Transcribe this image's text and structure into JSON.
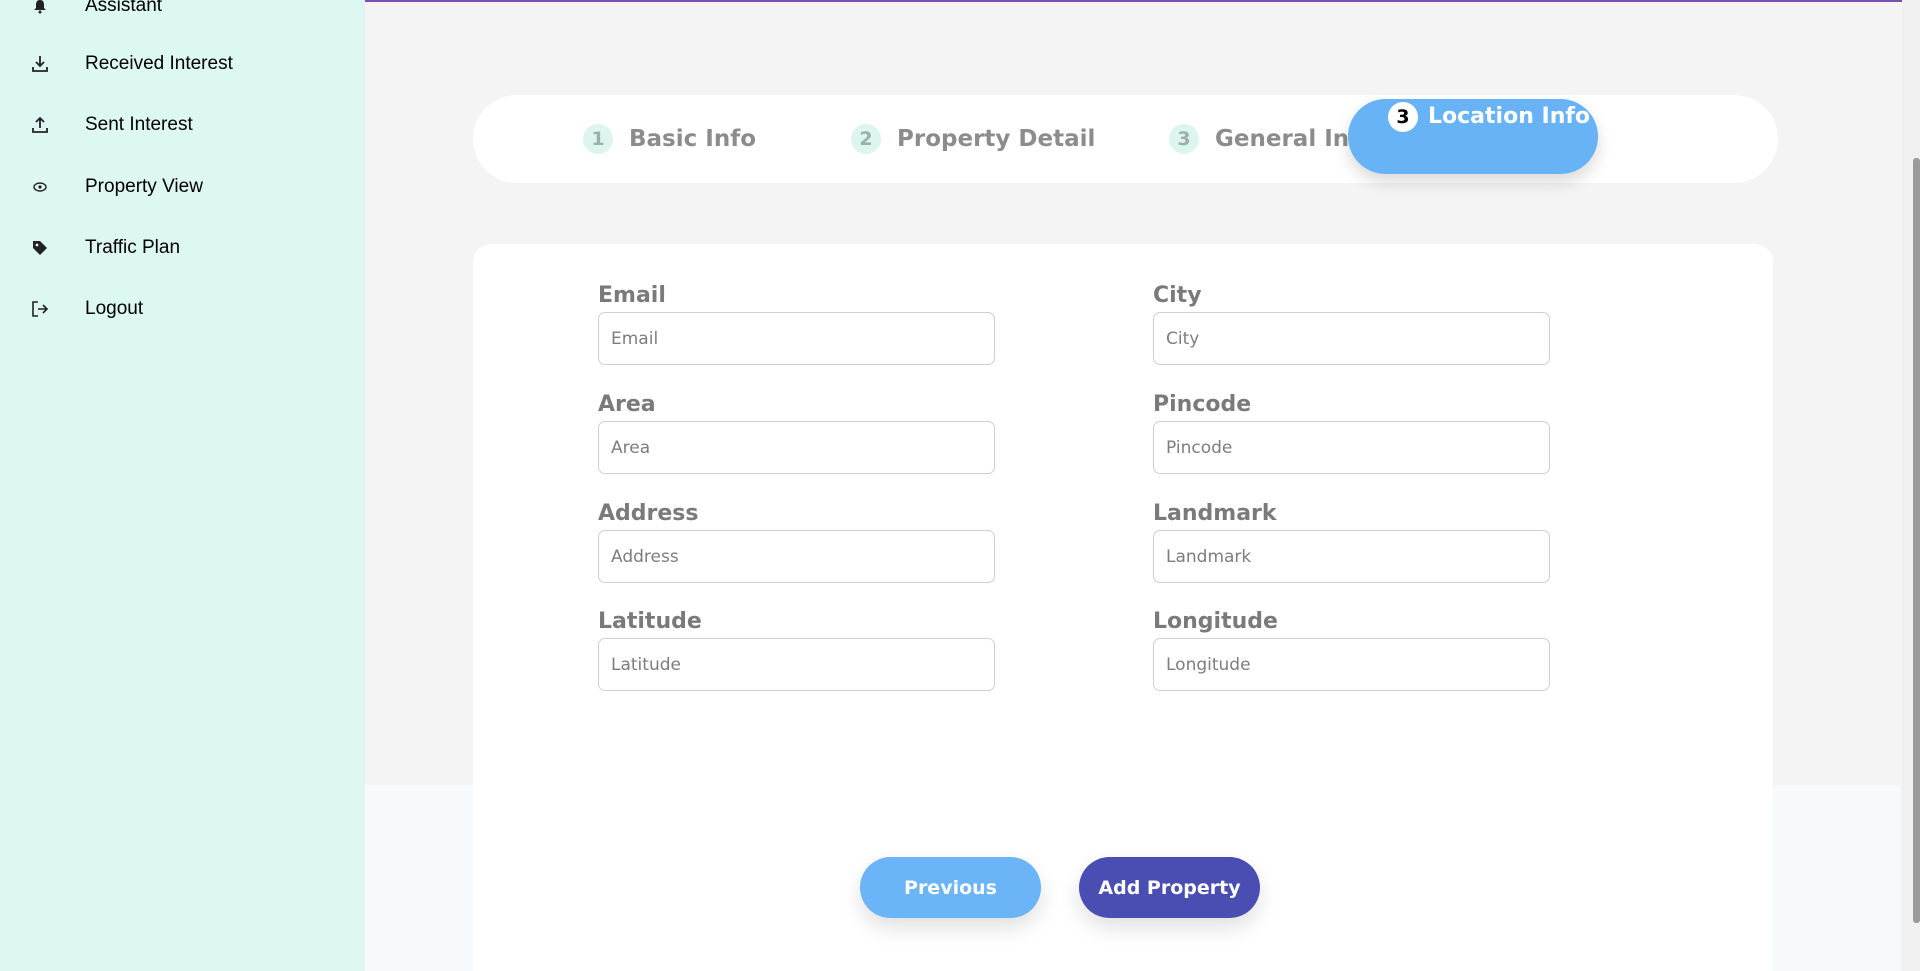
{
  "sidebar": {
    "items": [
      {
        "label": "Assistant",
        "icon": "bell-icon"
      },
      {
        "label": "Received Interest",
        "icon": "download-icon"
      },
      {
        "label": "Sent Interest",
        "icon": "upload-icon"
      },
      {
        "label": "Property View",
        "icon": "eye-icon"
      },
      {
        "label": "Traffic Plan",
        "icon": "tag-icon"
      },
      {
        "label": "Logout",
        "icon": "logout-icon"
      }
    ]
  },
  "stepper": {
    "steps": [
      {
        "num": "1",
        "label": "Basic Info"
      },
      {
        "num": "2",
        "label": "Property Detail"
      },
      {
        "num": "3",
        "label": "General Info"
      },
      {
        "num": "3",
        "label": "Location Info",
        "active": true
      }
    ]
  },
  "form": {
    "email": {
      "label": "Email",
      "placeholder": "Email"
    },
    "city": {
      "label": "City",
      "placeholder": "City"
    },
    "area": {
      "label": "Area",
      "placeholder": "Area"
    },
    "pincode": {
      "label": "Pincode",
      "placeholder": "Pincode"
    },
    "address": {
      "label": "Address",
      "placeholder": "Address"
    },
    "landmark": {
      "label": "Landmark",
      "placeholder": "Landmark"
    },
    "latitude": {
      "label": "Latitude",
      "placeholder": "Latitude"
    },
    "longitude": {
      "label": "Longitude",
      "placeholder": "Longitude"
    }
  },
  "buttons": {
    "previous": "Previous",
    "add_property": "Add Property"
  },
  "colors": {
    "sidebar_bg": "#ddf7f3",
    "active_step": "#68b2f6",
    "primary_button": "#4a4eb2",
    "secondary_button": "#6ab4f7"
  }
}
